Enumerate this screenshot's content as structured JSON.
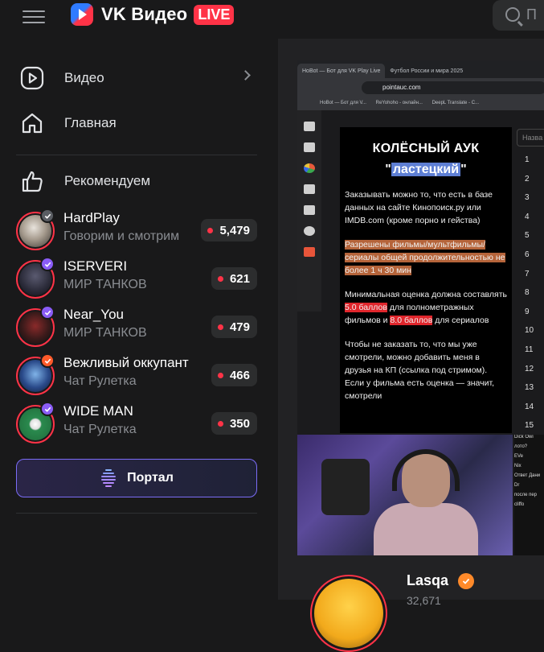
{
  "header": {
    "app_name": "VK Видео",
    "live_label": "LIVE",
    "search_placeholder": "П"
  },
  "sidebar": {
    "nav": [
      {
        "label": "Видео",
        "icon": "video-icon"
      },
      {
        "label": "Главная",
        "icon": "home-icon"
      }
    ],
    "recommended_label": "Рекомендуем",
    "streams": [
      {
        "name": "HardPlay",
        "category": "Говорим и смотрим",
        "viewers": "5,479",
        "badge_color": "#5a5d63"
      },
      {
        "name": "ISERVERI",
        "category": "МИР ТАНКОВ",
        "viewers": "621",
        "badge_color": "#8a5cf6"
      },
      {
        "name": "Near_You",
        "category": "МИР ТАНКОВ",
        "viewers": "479",
        "badge_color": "#8a5cf6"
      },
      {
        "name": "Вежливый оккупант",
        "category": "Чат Рулетка",
        "viewers": "466",
        "badge_color": "#ff5a2a"
      },
      {
        "name": "WIDE MAN",
        "category": "Чат Рулетка",
        "viewers": "350",
        "badge_color": "#8a5cf6"
      }
    ],
    "portal_label": "Портал"
  },
  "player": {
    "tabs": [
      "HoBot — Бот для VK Play Live",
      "Футбол России и мира 2025"
    ],
    "url": "pointauc.com",
    "bookmarks": [
      "HoBot — Бот для V...",
      "ReYohoho - онлайн...",
      "DeepL Translate - С..."
    ],
    "auction": {
      "title": "КОЛЁСНЫЙ АУК",
      "quote_open": "\"",
      "subtitle": "ластецкий",
      "quote_close": "\"",
      "p1": "Заказывать можно то, что есть в базе данных на сайте Кинопоиск.ру или IMDB.com (кроме порно и гейства)",
      "p2": "Разрешены фильмы/мультфильмы/ сериалы общей продолжительностью не более 1 ч 30 мин",
      "p3_a": "Минимальная оценка должна составлять ",
      "p3_b": "5.0 баллов",
      "p3_c": " для полнометражных фильмов и ",
      "p3_d": "8.0 баллов",
      "p3_e": " для сериалов",
      "p4": "Чтобы не заказать то, что мы уже смотрели, можно добавить меня в друзья на КП (ссылка под стримом). Если у фильма есть оценка — значит, смотрели"
    },
    "name_field_placeholder": "Назва",
    "ranks": [
      "1",
      "2",
      "3",
      "4",
      "5",
      "6",
      "7",
      "8",
      "9",
      "10",
      "11",
      "12",
      "13",
      "14",
      "15"
    ],
    "chat_lines": [
      "Dick Owi",
      "лото?",
      "EVe",
      "Nix",
      "Ответ Дани",
      "Dr",
      "после пер",
      "cliffo"
    ]
  },
  "channel": {
    "name": "Lasqa",
    "subscribers": "32,671"
  }
}
